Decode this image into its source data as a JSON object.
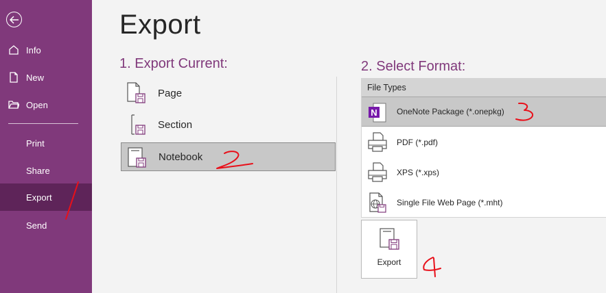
{
  "sidebar": {
    "items": [
      {
        "label": "Info",
        "icon": "info-icon"
      },
      {
        "label": "New",
        "icon": "new-icon"
      },
      {
        "label": "Open",
        "icon": "open-folder-icon"
      },
      {
        "label": "Print"
      },
      {
        "label": "Share"
      },
      {
        "label": "Export",
        "active": true
      },
      {
        "label": "Send"
      }
    ]
  },
  "main": {
    "title": "Export",
    "step1": {
      "heading": "1. Export Current:",
      "options": [
        {
          "label": "Page"
        },
        {
          "label": "Section"
        },
        {
          "label": "Notebook",
          "selected": true
        }
      ]
    },
    "step2": {
      "heading": "2. Select Format:",
      "list_header": "File Types",
      "formats": [
        {
          "label": "OneNote Package (*.onepkg)",
          "icon": "onenote-icon",
          "selected": true
        },
        {
          "label": "PDF (*.pdf)",
          "icon": "printer-icon"
        },
        {
          "label": "XPS (*.xps)",
          "icon": "printer-icon"
        },
        {
          "label": "Single File Web Page (*.mht)",
          "icon": "web-page-icon"
        }
      ]
    },
    "export_button": {
      "label": "Export"
    }
  },
  "annotations": {
    "marks": [
      "1",
      "2",
      "3",
      "4"
    ],
    "color": "#e8101a"
  },
  "colors": {
    "sidebar": "#80397b",
    "sidebar_active": "#5e2459",
    "accent": "#80397b",
    "selected_bg": "#c8c8c8"
  }
}
